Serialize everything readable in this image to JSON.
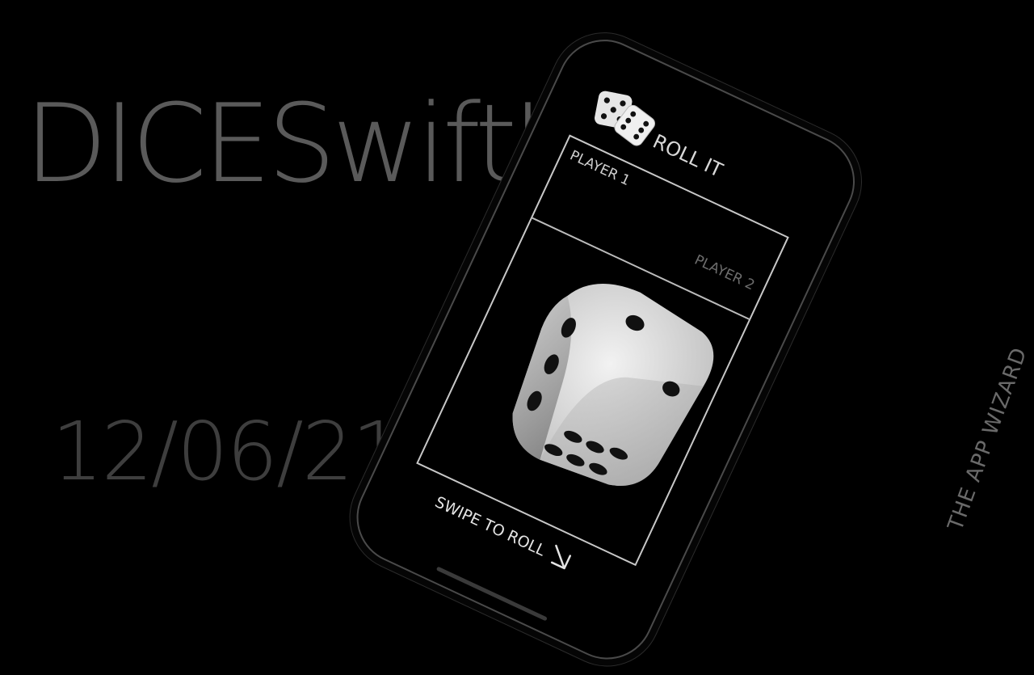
{
  "hero": {
    "title": "DICESwiftUI",
    "date": "12/06/21"
  },
  "brand": {
    "vertical_text": "THE APP WIZARD"
  },
  "app": {
    "logo_icon": "dice-pair-icon",
    "title": "ROLL IT",
    "board": {
      "player1": "PLAYER 1",
      "player2": "PLAYER 2",
      "die_icon": "die-3d-icon"
    },
    "swipe_label": "SWIPE TO ROLL",
    "swipe_icon": "arrow-down-right-icon"
  },
  "colors": {
    "background": "#000000",
    "hero_title": "#5a5a5a",
    "hero_date": "#3e3e3e",
    "die_face": "#d9d9d9",
    "pip": "#111111"
  }
}
